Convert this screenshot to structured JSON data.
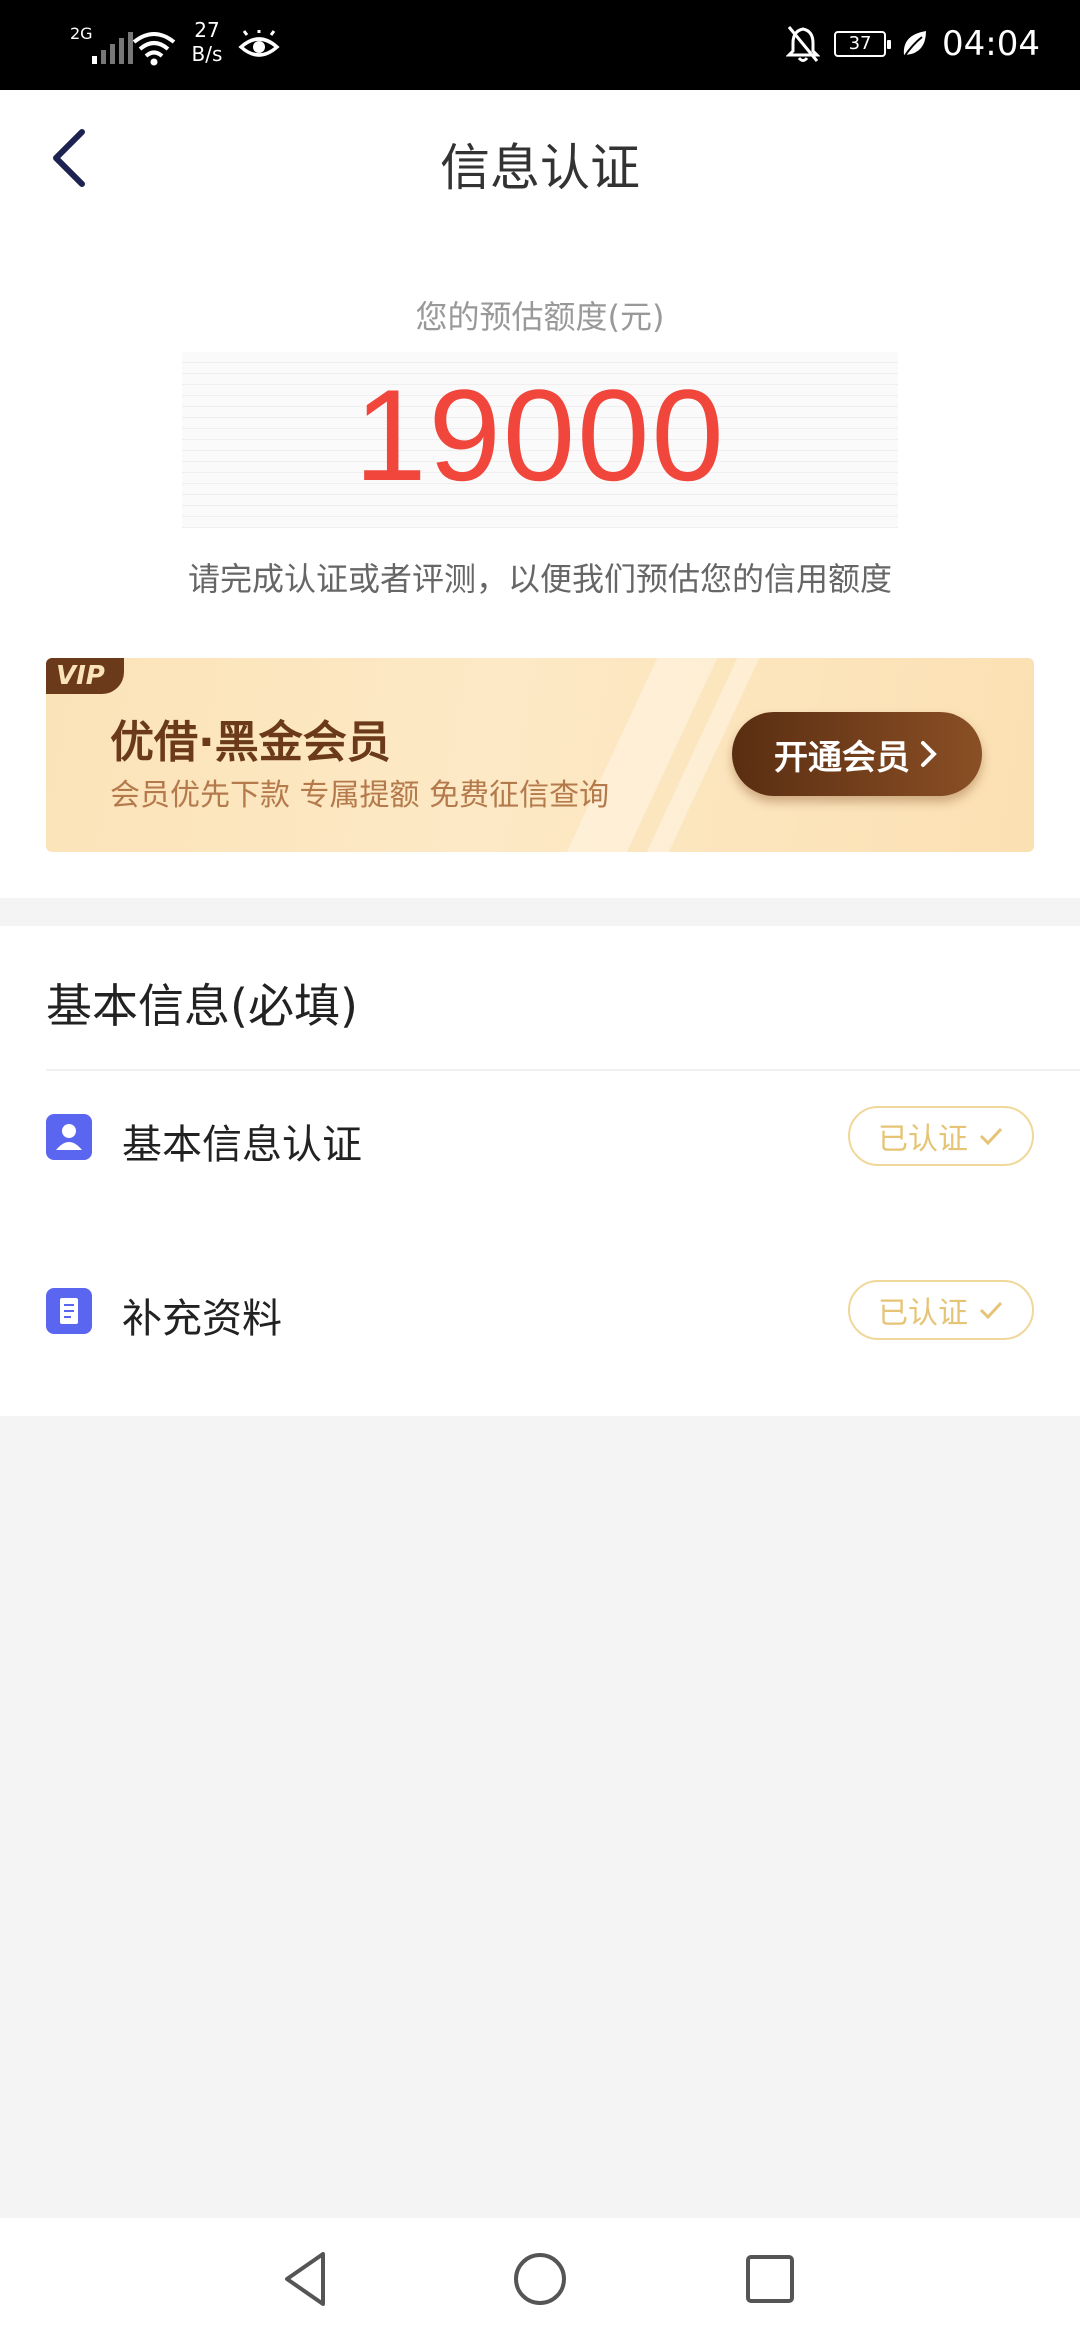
{
  "status_bar": {
    "network": "2G",
    "speed_value": "27",
    "speed_unit": "B/s",
    "battery": "37",
    "time": "04:04",
    "icons": [
      "signal-icon",
      "wifi-icon",
      "eye-icon",
      "bell-off-icon",
      "battery-icon",
      "leaf-icon"
    ]
  },
  "header": {
    "title": "信息认证",
    "back_icon": "chevron-left-icon"
  },
  "quota": {
    "label": "您的预估额度(元)",
    "value": "19000",
    "tip": "请完成认证或者评测，以便我们预估您的信用额度"
  },
  "vip": {
    "tag": "VIP",
    "title": "优借·黑金会员",
    "subtitle": "会员优先下款  专属提额  免费征信查询",
    "button_label": "开通会员"
  },
  "basic_info": {
    "title": "基本信息(必填)",
    "items": [
      {
        "label": "基本信息认证",
        "status": "已认证",
        "icon": "user-icon"
      },
      {
        "label": "补充资料",
        "status": "已认证",
        "icon": "document-icon"
      }
    ]
  },
  "colors": {
    "accent_red": "#f0463c",
    "icon_blue": "#5a66f0",
    "verified_gold": "#e6c476",
    "vip_brown": "#6b3a1a"
  }
}
